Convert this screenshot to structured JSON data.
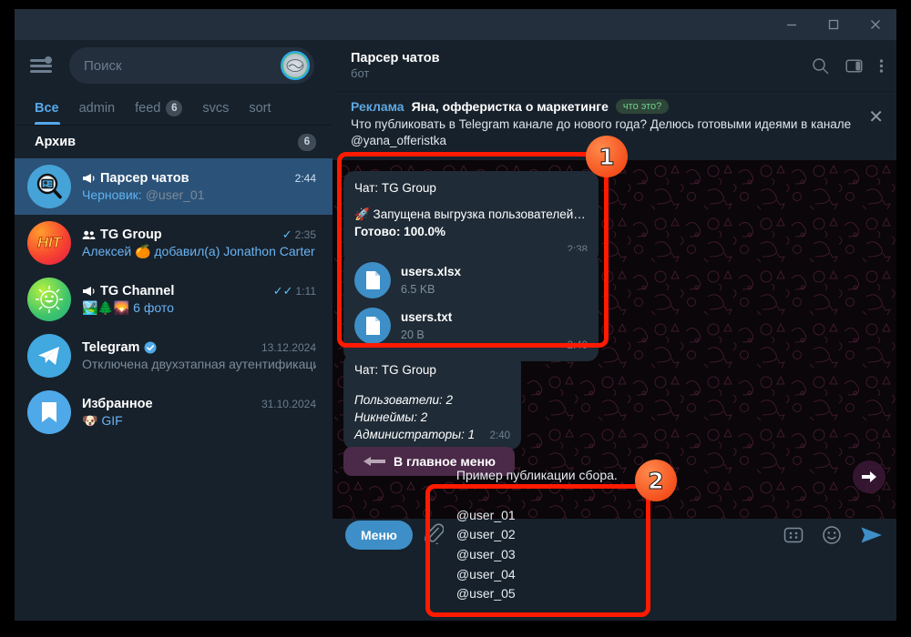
{
  "window": {
    "controls": [
      {
        "name": "minimize",
        "glyph": "minimize-icon"
      },
      {
        "name": "maximize",
        "glyph": "maximize-icon"
      },
      {
        "name": "close",
        "glyph": "close-icon"
      }
    ]
  },
  "sidebar": {
    "menu_icon": "hamburger-menu-icon",
    "search": {
      "placeholder": "Поиск"
    },
    "avatar_initials": "",
    "tabs": [
      {
        "label": "Все",
        "count": "",
        "active": true
      },
      {
        "label": "admin",
        "count": "",
        "active": false
      },
      {
        "label": "feed",
        "count": "6",
        "active": false
      },
      {
        "label": "svcs",
        "count": "",
        "active": false
      },
      {
        "label": "sort",
        "count": "",
        "active": false
      }
    ],
    "archive": {
      "label": "Архив",
      "count": "6"
    },
    "chats": [
      {
        "name": "Парсер чатов",
        "time": "2:44",
        "preview_prefix": "Черновик:",
        "preview": "@user_01",
        "avatar": "search-contact-icon",
        "badge_icon": "megaphone-icon",
        "selected": true,
        "tick": ""
      },
      {
        "name": "TG Group",
        "time": "2:35",
        "preview_prefix": "",
        "preview": "Алексей 🍊 добавил(а) Jonathon Carter III",
        "avatar": "hit-logo",
        "badge_icon": "group-icon",
        "selected": false,
        "tick": "✓"
      },
      {
        "name": "TG Channel",
        "time": "1:11",
        "preview_prefix": "",
        "preview": "🏞️🌲🌄 6 фото",
        "avatar": "sun-emoji",
        "badge_icon": "channel-icon",
        "selected": false,
        "tick": "✓✓"
      },
      {
        "name": "Telegram",
        "time": "13.12.2024",
        "preview_prefix": "",
        "preview": "Отключена двухэтапная аутентификация!…",
        "avatar": "telegram-logo",
        "badge_icon": "verified-icon",
        "selected": false,
        "tick": ""
      },
      {
        "name": "Избранное",
        "time": "31.10.2024",
        "preview_prefix": "",
        "preview": "🐶 GIF",
        "avatar": "bookmark-icon",
        "badge_icon": "",
        "selected": false,
        "tick": ""
      }
    ]
  },
  "chat_header": {
    "title": "Парсер чатов",
    "subtitle": "бот",
    "icons": [
      "search-icon",
      "sidebar-toggle-icon",
      "more-vertical-icon"
    ]
  },
  "ad": {
    "label": "Реклама",
    "title": "Яна, офферистка о маркетинге",
    "chip": "что это?",
    "body": "Что публиковать в Telegram канале до нового года? Делюсь готовыми идеями в канале @yana_offeristka",
    "close_icon": "close-icon"
  },
  "messages": [
    {
      "chat_line": "Чат: TG Group",
      "text_line_1": "🚀 Запущена выгрузка пользователей…",
      "text_line_2": "Готово: 100.0%",
      "time": "2:38"
    },
    {
      "files": [
        {
          "name": "users.xlsx",
          "size": "6.5 KB"
        },
        {
          "name": "users.txt",
          "size": "20 B"
        }
      ],
      "time": "2:40"
    },
    {
      "chat_line": "Чат: TG Group",
      "stats": [
        "Пользователи: 2",
        "Никнеймы: 2",
        "Администраторы: 1"
      ],
      "time": "2:40"
    }
  ],
  "keyboard_button": {
    "label": "В главное меню",
    "emoji_label": "BACK"
  },
  "forward_button_icon": "forward-arrow-icon",
  "composer": {
    "menu_label": "Меню",
    "attach_icon": "paperclip-icon",
    "draft_text": "Пример публикации сбора.\n\n@user_01\n@user_02\n@user_03\n@user_04\n@user_05",
    "icons": [
      "keyboard-icon",
      "emoji-icon",
      "send-icon"
    ]
  },
  "annotations": [
    {
      "number": "1"
    },
    {
      "number": "2"
    }
  ],
  "colors": {
    "accent": "#3e8fc7",
    "selected_chat": "#2b5278",
    "annotation_red": "#ff1a00",
    "annotation_badge": "#f4511e",
    "sidebar_bg": "#17212b",
    "titlebar_bg": "#242f3d"
  }
}
